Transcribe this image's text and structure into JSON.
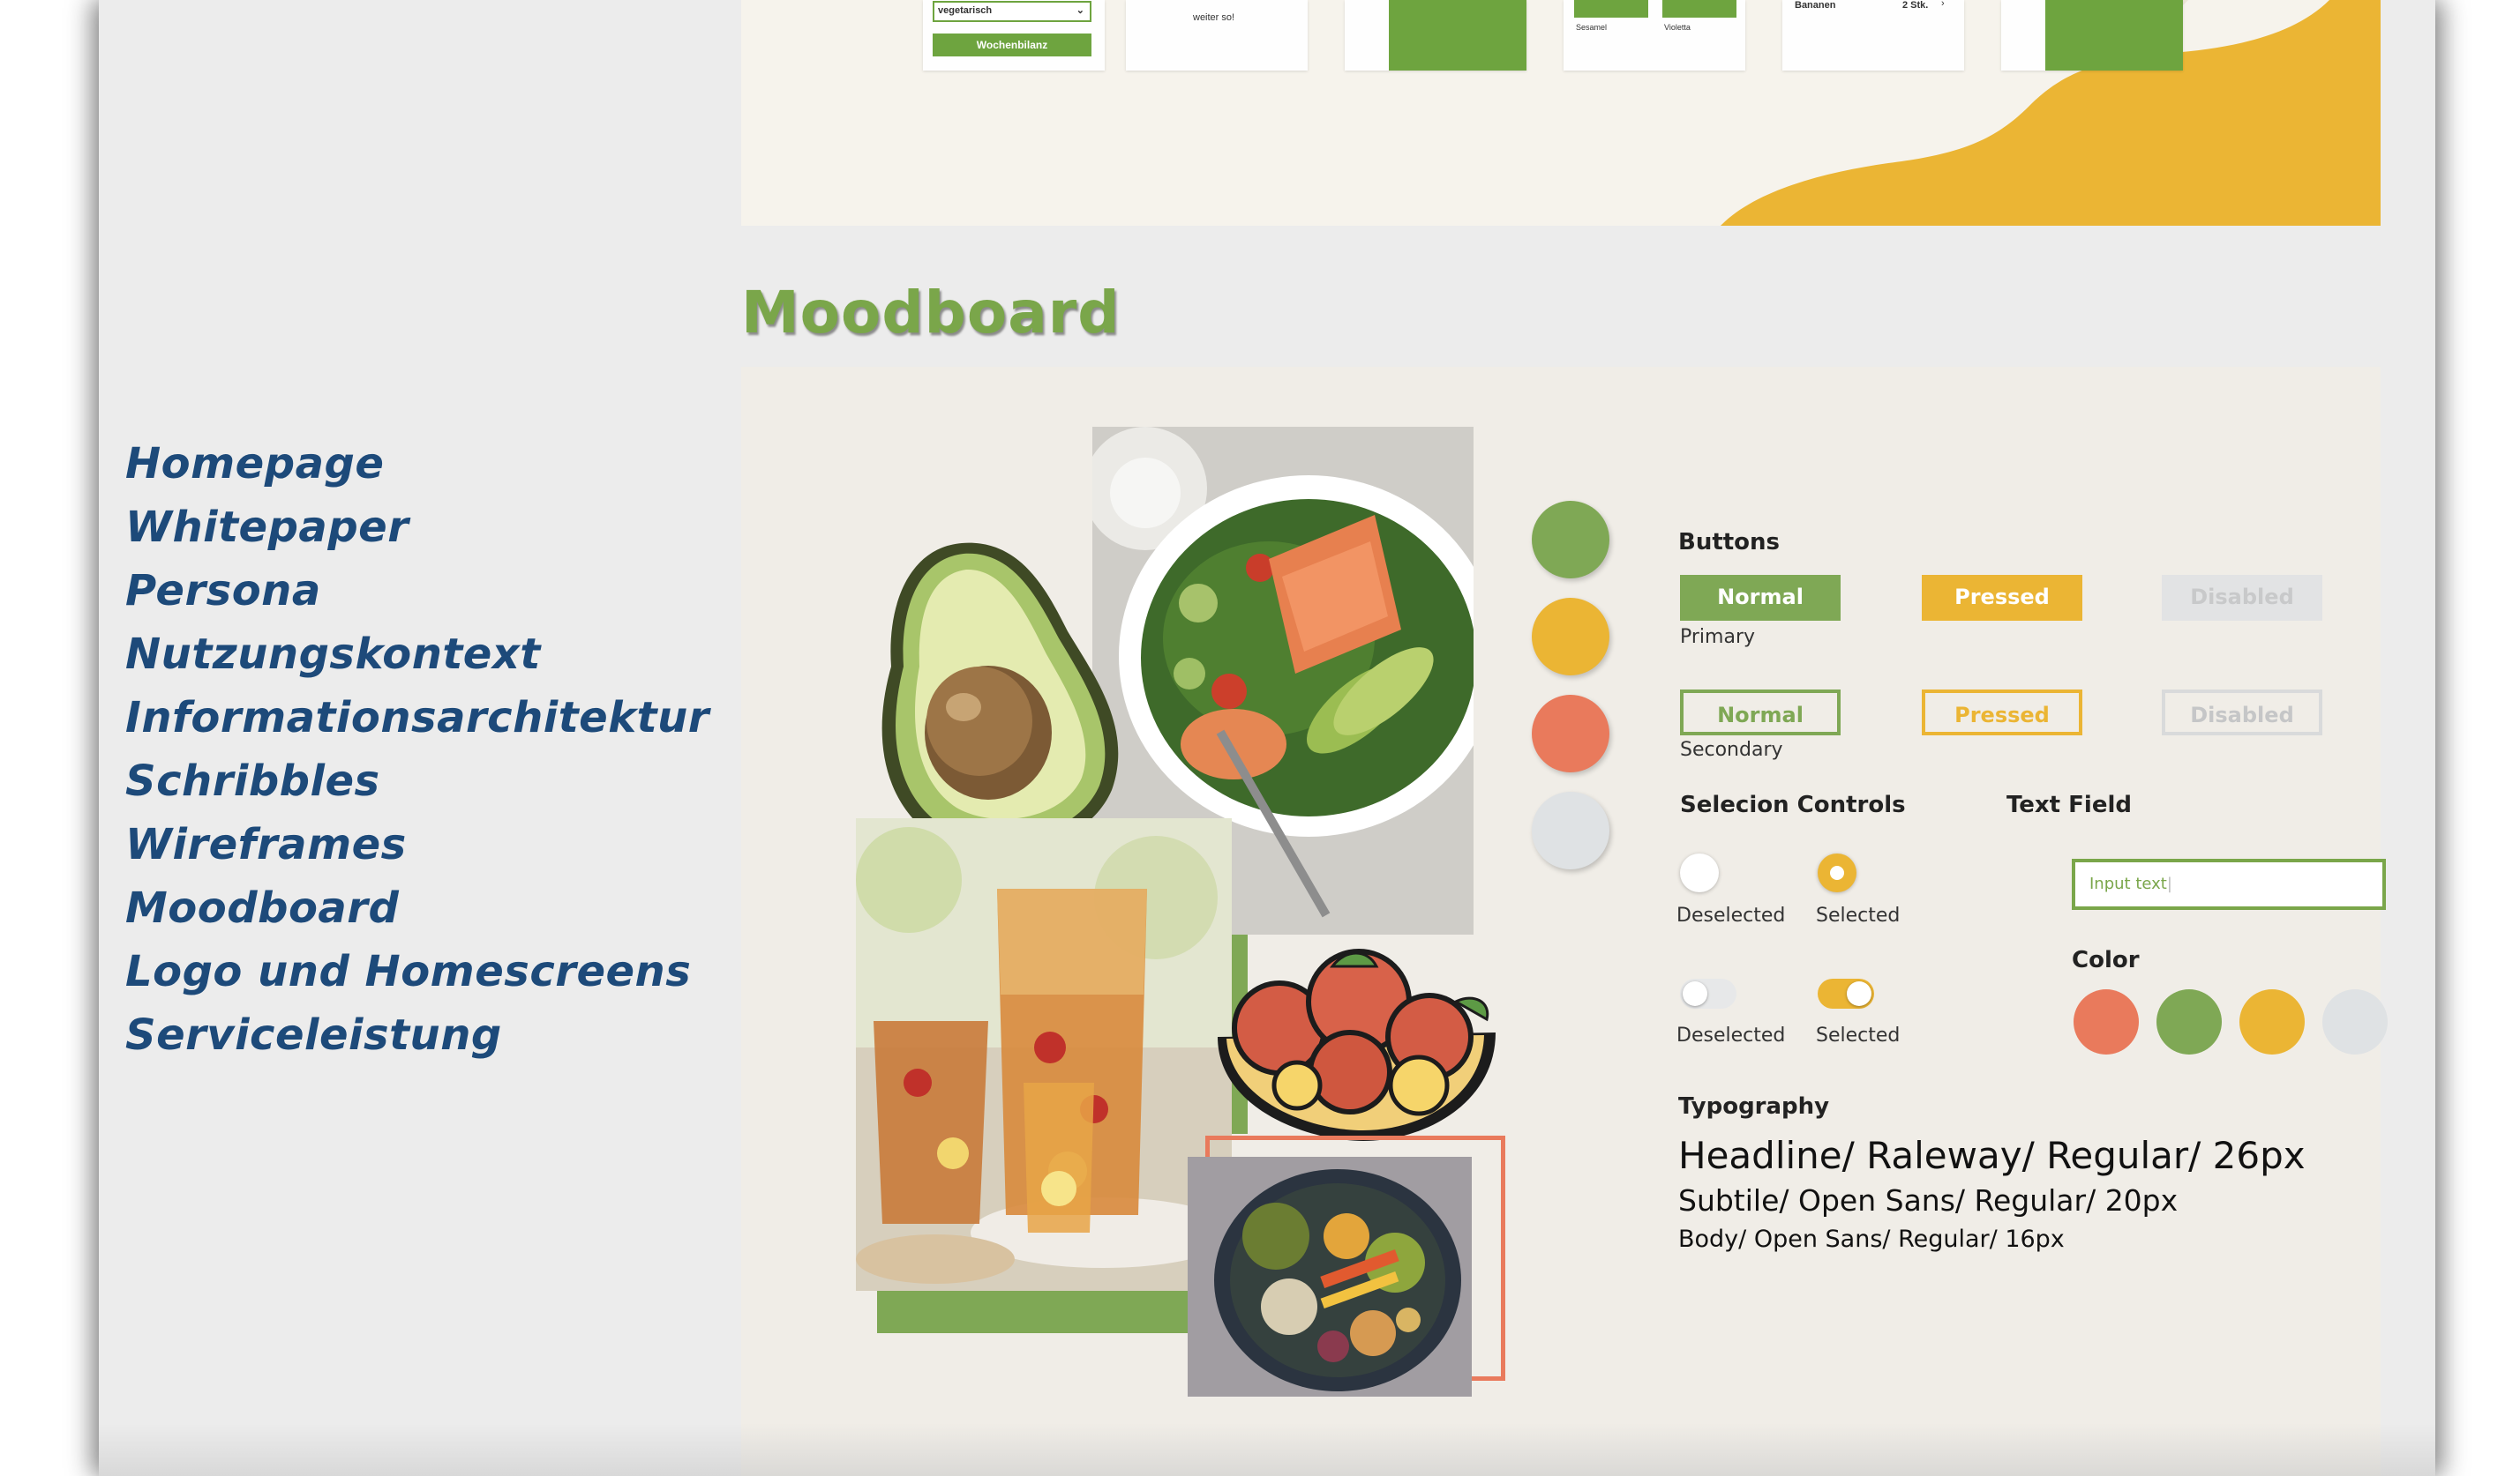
{
  "nav": {
    "items": [
      "Homepage",
      "Whitepaper",
      "Persona",
      "Nutzungskontext",
      "Informationsarchitektur",
      "Schribbles",
      "Wireframes",
      "Moodboard",
      "Logo und Homescreens",
      "Serviceleistung"
    ]
  },
  "wireframes": {
    "card1": {
      "select_value": "vegetarisch",
      "button_label": "Wochenbilanz"
    },
    "card2": {
      "text": "weiter so!"
    },
    "card4": {
      "label_a": "Sesamel",
      "label_b": "Violetta"
    },
    "card5": {
      "item": "Bananen",
      "qty": "2 Stk."
    }
  },
  "moodboard": {
    "title": "Moodboard",
    "buttons": {
      "label": "Buttons",
      "normal": "Normal",
      "pressed": "Pressed",
      "disabled": "Disabled",
      "primary_caption": "Primary",
      "secondary_caption": "Secondary"
    },
    "selection": {
      "label": "Selecion Controls",
      "deselected": "Deselected",
      "selected": "Selected"
    },
    "text_field": {
      "label": "Text Field",
      "placeholder": "Input text"
    },
    "color": {
      "label": "Color",
      "swatches": [
        "#e97a5c",
        "#7fa855",
        "#ebb534",
        "#dfe2e4"
      ]
    },
    "typography": {
      "label": "Typography",
      "headline": "Headline/ Raleway/ Regular/ 26px",
      "subtitle": "Subtile/ Open Sans/ Regular/ 20px",
      "body": "Body/ Open Sans/ Regular/ 16px"
    }
  },
  "colors": {
    "green": "#7fa855",
    "yellow": "#ebb534",
    "orange": "#e97a5c",
    "grey": "#dfe2e4",
    "nav_blue": "#1d4a7a"
  }
}
